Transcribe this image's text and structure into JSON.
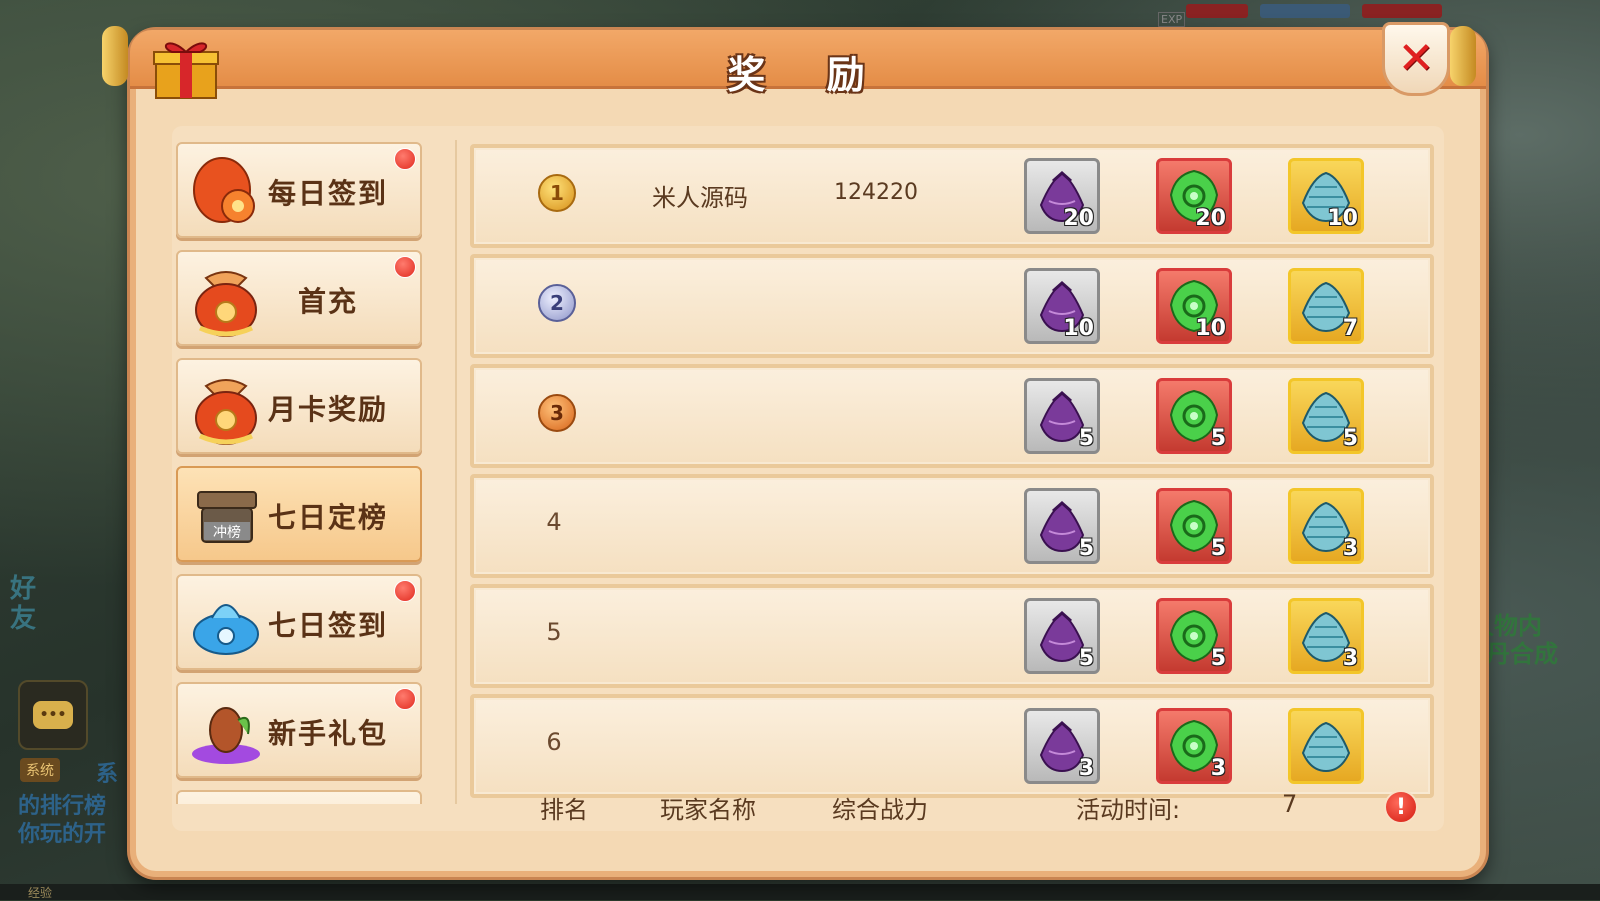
{
  "dialog": {
    "title": "奖 励",
    "close_icon": "close-icon"
  },
  "sidebar": {
    "items": [
      {
        "label": "每日签到",
        "icon": "red-pouch-icon",
        "badge": true,
        "active": false
      },
      {
        "label": "首充",
        "icon": "lucky-bag-icon",
        "badge": true,
        "active": false
      },
      {
        "label": "月卡奖励",
        "icon": "lucky-bag-icon",
        "badge": false,
        "active": false
      },
      {
        "label": "七日定榜",
        "icon": "ranking-chest-icon",
        "badge_text": "冲榜",
        "badge": false,
        "active": true
      },
      {
        "label": "七日签到",
        "icon": "blue-pouch-icon",
        "badge": true,
        "active": false
      },
      {
        "label": "新手礼包",
        "icon": "purple-egg-icon",
        "badge": true,
        "active": false
      }
    ]
  },
  "ranking": {
    "rows": [
      {
        "rank": "1",
        "medal": "gold",
        "player": "米人源码",
        "power": "124220",
        "rewards": [
          "20",
          "20",
          "10"
        ]
      },
      {
        "rank": "2",
        "medal": "silver",
        "player": "",
        "power": "",
        "rewards": [
          "10",
          "10",
          "7"
        ]
      },
      {
        "rank": "3",
        "medal": "bronze",
        "player": "",
        "power": "",
        "rewards": [
          "5",
          "5",
          "5"
        ]
      },
      {
        "rank": "4",
        "medal": "",
        "player": "",
        "power": "",
        "rewards": [
          "5",
          "5",
          "3"
        ]
      },
      {
        "rank": "5",
        "medal": "",
        "player": "",
        "power": "",
        "rewards": [
          "5",
          "5",
          "3"
        ]
      },
      {
        "rank": "6",
        "medal": "",
        "player": "",
        "power": "",
        "rewards": [
          "3",
          "3",
          ""
        ]
      }
    ],
    "reward_items": [
      "purple-pouch-icon",
      "green-jade-icon",
      "blue-pouch-icon"
    ]
  },
  "footer": {
    "rank_label": "排名",
    "player_label": "玩家名称",
    "power_label": "综合战力",
    "time_label": "活动时间:",
    "time_value": "7"
  },
  "background": {
    "exp_label": "EXP",
    "side_left_1": "好",
    "side_left_2": "友",
    "side_right_1": "人物内",
    "side_right_2": "内丹合成",
    "chat_icon": "chat-icon",
    "system_tag": "系统",
    "system_text_1": "系",
    "system_text_2": "的排行榜",
    "system_text_3": "你玩的开",
    "exp_bottom": "经验"
  }
}
